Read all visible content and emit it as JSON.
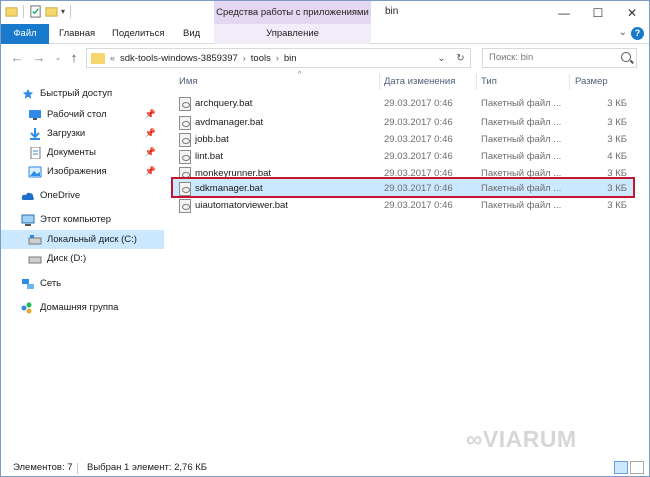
{
  "titlebar": {
    "context_tab": "Средства работы с приложениями",
    "window_title": "bin",
    "minimize": "—",
    "maximize": "☐",
    "close": "✕"
  },
  "ribbon": {
    "tabs": [
      "Файл",
      "Главная",
      "Поделиться",
      "Вид",
      "Управление"
    ]
  },
  "address": {
    "overflow": "«",
    "crumbs": [
      "sdk-tools-windows-3859397",
      "tools",
      "bin"
    ]
  },
  "search": {
    "placeholder": "Поиск: bin"
  },
  "navpane": {
    "items": [
      {
        "label": "Быстрый доступ",
        "icon": "star-icon"
      },
      {
        "label": "Рабочий стол",
        "icon": "desktop-icon",
        "pinned": true
      },
      {
        "label": "Загрузки",
        "icon": "download-icon",
        "pinned": true
      },
      {
        "label": "Документы",
        "icon": "documents-icon",
        "pinned": true
      },
      {
        "label": "Изображения",
        "icon": "pictures-icon",
        "pinned": true
      },
      {
        "label": "OneDrive",
        "icon": "cloud-icon"
      },
      {
        "label": "Этот компьютер",
        "icon": "computer-icon"
      },
      {
        "label": "Локальный диск (C:)",
        "icon": "drive-icon",
        "selected": true
      },
      {
        "label": "Диск (D:)",
        "icon": "drive-icon"
      },
      {
        "label": "Сеть",
        "icon": "network-icon"
      },
      {
        "label": "Домашняя группа",
        "icon": "homegroup-icon"
      }
    ]
  },
  "columns": [
    "Имя",
    "Дата изменения",
    "Тип",
    "Размер"
  ],
  "files": [
    {
      "name": "archquery.bat",
      "date": "29.03.2017 0:46",
      "type": "Пакетный файл ...",
      "size": "3 КБ"
    },
    {
      "name": "avdmanager.bat",
      "date": "29.03.2017 0:46",
      "type": "Пакетный файл ...",
      "size": "3 КБ"
    },
    {
      "name": "jobb.bat",
      "date": "29.03.2017 0:46",
      "type": "Пакетный файл ...",
      "size": "3 КБ"
    },
    {
      "name": "lint.bat",
      "date": "29.03.2017 0:46",
      "type": "Пакетный файл ...",
      "size": "4 КБ"
    },
    {
      "name": "monkeyrunner.bat",
      "date": "29.03.2017 0:46",
      "type": "Пакетный файл ...",
      "size": "3 КБ"
    },
    {
      "name": "sdkmanager.bat",
      "date": "29.03.2017 0:46",
      "type": "Пакетный файл ...",
      "size": "3 КБ",
      "selected": true
    },
    {
      "name": "uiautomatorviewer.bat",
      "date": "29.03.2017 0:46",
      "type": "Пакетный файл ...",
      "size": "3 КБ"
    }
  ],
  "status": {
    "count": "Элементов: 7",
    "selection": "Выбран 1 элемент: 2,76 КБ"
  },
  "watermark": "VIARUM",
  "colors": {
    "accent": "#1979ca",
    "selection": "#cce8ff",
    "highlight_box": "#c5142d",
    "context_tab": "#e3d7f1"
  }
}
